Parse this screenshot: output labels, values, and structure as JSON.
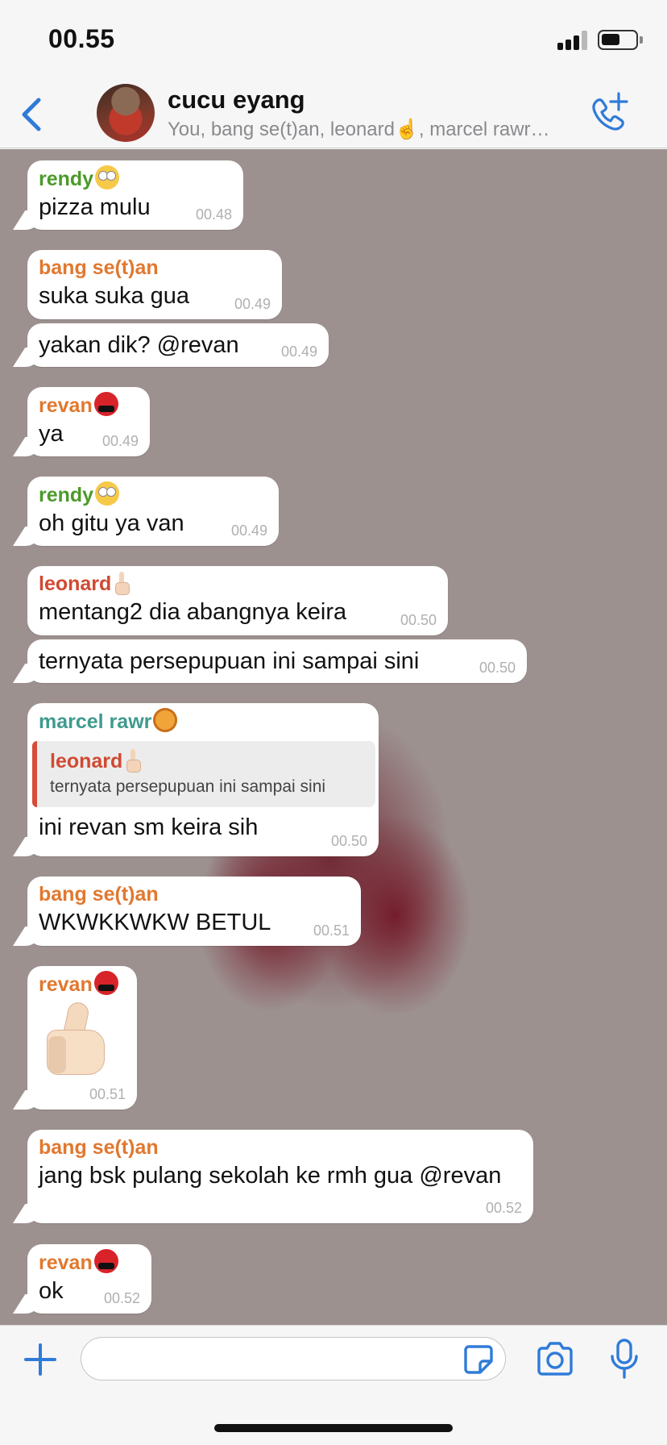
{
  "status_bar": {
    "time": "00.55"
  },
  "header": {
    "back_icon": "chevron-left-icon",
    "title": "cucu eyang",
    "subtitle": "You, bang se(t)an, leonard☝️, marcel rawr…",
    "call_icon": "add-call-icon",
    "accent_color": "#2f7bd8"
  },
  "messages": [
    {
      "sender": "rendy",
      "sender_color": "#4c9a2a",
      "sender_emoji": "face-rolling-eyes-emoji",
      "text": "pizza mulu",
      "time": "00.48"
    },
    {
      "sender": "bang se(t)an",
      "sender_color": "#e1782f",
      "text": "suka suka gua",
      "time": "00.49"
    },
    {
      "text": "yakan dik? @revan",
      "time": "00.49"
    },
    {
      "sender": "revan",
      "sender_color": "#e1782f",
      "sender_emoji": "face-with-symbols-emoji",
      "text": "ya",
      "time": "00.49"
    },
    {
      "sender": "rendy",
      "sender_color": "#4c9a2a",
      "sender_emoji": "face-rolling-eyes-emoji",
      "text": "oh gitu ya van",
      "time": "00.49"
    },
    {
      "sender": "leonard",
      "sender_color": "#d04a32",
      "sender_emoji": "index-pointing-up-emoji",
      "text": "mentang2 dia abangnya keira",
      "time": "00.50"
    },
    {
      "text": "ternyata persepupuan ini sampai sini",
      "time": "00.50"
    },
    {
      "sender": "marcel rawr",
      "sender_color": "#3f9a8f",
      "sender_emoji": "lion-emoji",
      "quote_sender": "leonard",
      "quote_text": "ternyata persepupuan ini sampai sini",
      "text": "ini revan sm keira sih",
      "time": "00.50"
    },
    {
      "sender": "bang se(t)an",
      "sender_color": "#e1782f",
      "text": "WKWKKWKW BETUL",
      "time": "00.51"
    },
    {
      "sender": "revan",
      "sender_color": "#e1782f",
      "sender_emoji": "face-with-symbols-emoji",
      "sticker": "thumbs-up-sticker",
      "time": "00.51"
    },
    {
      "sender": "bang se(t)an",
      "sender_color": "#e1782f",
      "text": "jang bsk pulang sekolah ke rmh gua @revan",
      "time": "00.52"
    },
    {
      "sender": "revan",
      "sender_color": "#e1782f",
      "sender_emoji": "face-with-symbols-emoji",
      "text": "ok",
      "time": "00.52"
    }
  ],
  "input_bar": {
    "placeholder": "",
    "icons": [
      "plus-icon",
      "sticker-icon",
      "camera-icon",
      "microphone-icon"
    ]
  }
}
